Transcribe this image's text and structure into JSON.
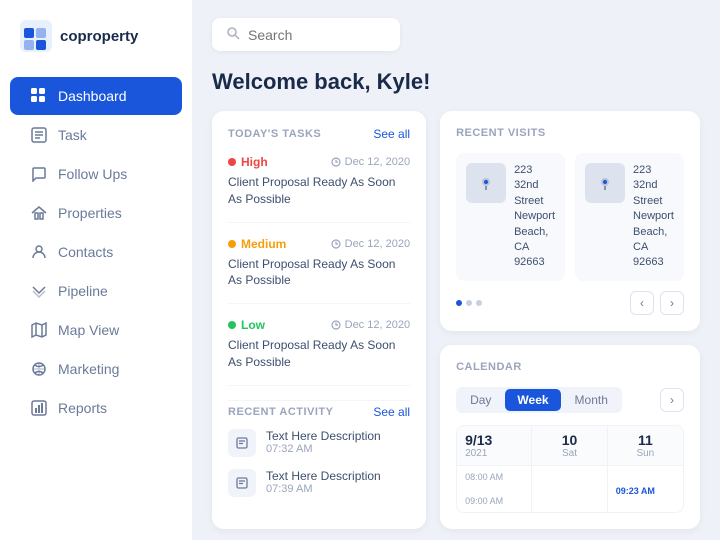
{
  "logo": {
    "text": "coproperty"
  },
  "nav": {
    "items": [
      {
        "id": "dashboard",
        "label": "Dashboard",
        "icon": "⊞",
        "active": true
      },
      {
        "id": "task",
        "label": "Task",
        "icon": "☰"
      },
      {
        "id": "followups",
        "label": "Follow Ups",
        "icon": "🔖"
      },
      {
        "id": "properties",
        "label": "Properties",
        "icon": "🏠"
      },
      {
        "id": "contacts",
        "label": "Contacts",
        "icon": "👤"
      },
      {
        "id": "pipeline",
        "label": "Pipeline",
        "icon": "▽"
      },
      {
        "id": "mapview",
        "label": "Map View",
        "icon": "🗺"
      },
      {
        "id": "marketing",
        "label": "Marketing",
        "icon": "◑"
      },
      {
        "id": "reports",
        "label": "Reports",
        "icon": "📊"
      }
    ]
  },
  "search": {
    "placeholder": "Search"
  },
  "welcome": {
    "title": "Welcome back, Kyle!"
  },
  "tasks": {
    "section_title": "TODAY'S TASKS",
    "see_all": "See all",
    "items": [
      {
        "priority": "High",
        "priority_class": "high",
        "date": "Dec 12, 2020",
        "description": "Client Proposal Ready As Soon As Possible"
      },
      {
        "priority": "Medium",
        "priority_class": "medium",
        "date": "Dec 12, 2020",
        "description": "Client Proposal Ready As Soon As Possible"
      },
      {
        "priority": "Low",
        "priority_class": "low",
        "date": "Dec 12, 2020",
        "description": "Client Proposal Ready As Soon As Possible"
      }
    ]
  },
  "recent_visits": {
    "section_title": "RECENT VISITS",
    "items": [
      {
        "address_line1": "223 32nd Street",
        "address_line2": "Newport Beach,",
        "address_line3": "CA 92663"
      },
      {
        "address_line1": "223 32nd Street",
        "address_line2": "Newport Beach,",
        "address_line3": "CA 92663"
      }
    ]
  },
  "calendar": {
    "section_title": "CALENDAR",
    "tabs": [
      {
        "label": "Day",
        "active": false
      },
      {
        "label": "Week",
        "active": true
      },
      {
        "label": "Month",
        "active": false
      }
    ],
    "columns": [
      {
        "date": "9/13",
        "year": "2021",
        "day": ""
      },
      {
        "date": "10",
        "year": "",
        "day": "Sat"
      },
      {
        "date": "11",
        "year": "",
        "day": "Sun"
      }
    ],
    "time_slots": [
      {
        "time": "08:00 AM",
        "event": ""
      },
      {
        "time": "09:00 AM",
        "event": "09:23 AM"
      }
    ]
  },
  "activity": {
    "section_title": "RECENT ACTIVITY",
    "see_all": "See all",
    "items": [
      {
        "text": "Text Here Description",
        "time": "07:32 AM"
      },
      {
        "text": "Text Here Description",
        "time": "07:39 AM"
      }
    ]
  }
}
